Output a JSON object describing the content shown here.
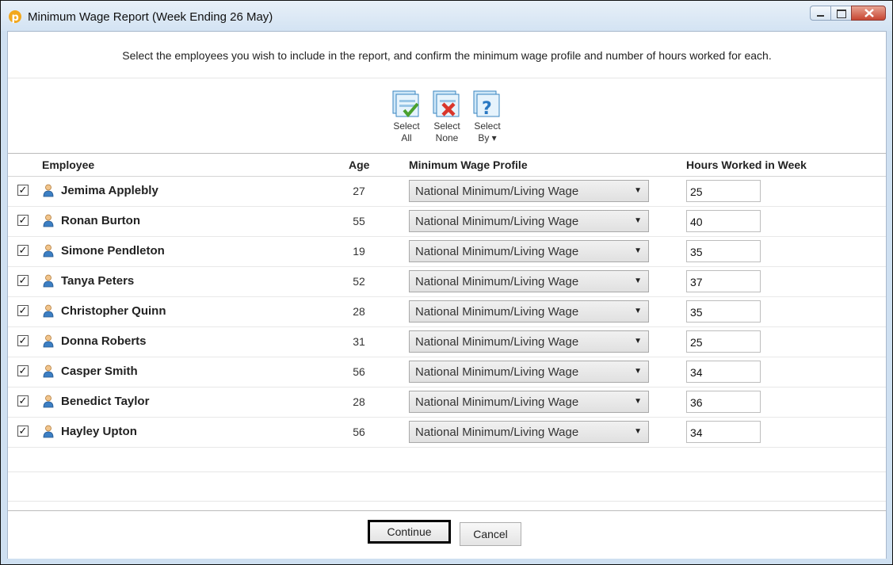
{
  "window": {
    "title": "Minimum Wage Report (Week Ending 26 May)"
  },
  "instructions": "Select the employees you wish to include in the report, and confirm the minimum wage profile and number of hours worked for each.",
  "toolbar": {
    "select_all": {
      "line1": "Select",
      "line2": "All",
      "icon": "select-all-icon"
    },
    "select_none": {
      "line1": "Select",
      "line2": "None",
      "icon": "select-none-icon"
    },
    "select_by": {
      "line1": "Select",
      "line2": "By ▾",
      "icon": "select-by-icon"
    }
  },
  "table": {
    "headers": {
      "employee": "Employee",
      "age": "Age",
      "profile": "Minimum Wage Profile",
      "hours": "Hours Worked in Week"
    },
    "rows": [
      {
        "checked": true,
        "name": "Jemima Applebly",
        "age": "27",
        "profile": "National Minimum/Living Wage",
        "hours": "25"
      },
      {
        "checked": true,
        "name": "Ronan Burton",
        "age": "55",
        "profile": "National Minimum/Living Wage",
        "hours": "40"
      },
      {
        "checked": true,
        "name": "Simone Pendleton",
        "age": "19",
        "profile": "National Minimum/Living Wage",
        "hours": "35"
      },
      {
        "checked": true,
        "name": "Tanya Peters",
        "age": "52",
        "profile": "National Minimum/Living Wage",
        "hours": "37"
      },
      {
        "checked": true,
        "name": "Christopher Quinn",
        "age": "28",
        "profile": "National Minimum/Living Wage",
        "hours": "35"
      },
      {
        "checked": true,
        "name": "Donna Roberts",
        "age": "31",
        "profile": "National Minimum/Living Wage",
        "hours": "25"
      },
      {
        "checked": true,
        "name": "Casper Smith",
        "age": "56",
        "profile": "National Minimum/Living Wage",
        "hours": "34"
      },
      {
        "checked": true,
        "name": "Benedict Taylor",
        "age": "28",
        "profile": "National Minimum/Living Wage",
        "hours": "36"
      },
      {
        "checked": true,
        "name": "Hayley Upton",
        "age": "56",
        "profile": "National Minimum/Living Wage",
        "hours": "34"
      }
    ]
  },
  "footer": {
    "continue_label": "Continue",
    "cancel_label": "Cancel"
  }
}
